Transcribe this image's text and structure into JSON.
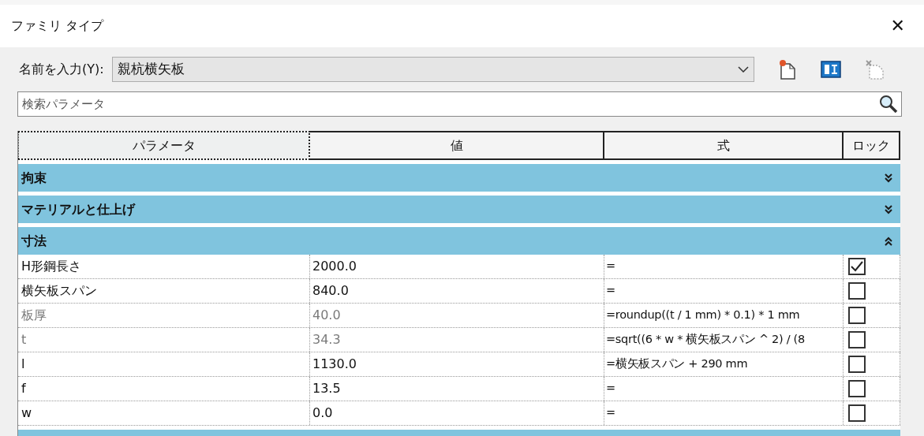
{
  "window": {
    "title": "ファミリ タイプ",
    "close": "✕"
  },
  "name_field": {
    "label": "名前を入力(Y):",
    "value": "親杭横矢板"
  },
  "search": {
    "placeholder": "検索パラメータ"
  },
  "columns": [
    "パラメータ",
    "値",
    "式",
    "ロック"
  ],
  "groups": [
    {
      "name": "拘束",
      "expanded": false
    },
    {
      "name": "マテリアルと仕上げ",
      "expanded": false
    },
    {
      "name": "寸法",
      "expanded": true,
      "rows": [
        {
          "parameter": "H形鋼長さ",
          "value": "2000.0",
          "formula": "=",
          "locked": true,
          "disabled": false
        },
        {
          "parameter": "横矢板スパン",
          "value": "840.0",
          "formula": "=",
          "locked": false,
          "disabled": false
        },
        {
          "parameter": "板厚",
          "value": "40.0",
          "formula": "=roundup((t / 1 mm) * 0.1) * 1 mm",
          "locked": false,
          "disabled": true
        },
        {
          "parameter": "t",
          "value": "34.3",
          "formula": "=sqrt((6 * w * 横矢板スパン ^ 2) / (8",
          "locked": false,
          "disabled": true
        },
        {
          "parameter": "l",
          "value": "1130.0",
          "formula": "=横矢板スパン + 290 mm",
          "locked": false,
          "disabled": false
        },
        {
          "parameter": "f",
          "value": "13.5",
          "formula": "=",
          "locked": false,
          "disabled": false
        },
        {
          "parameter": "w",
          "value": "0.0",
          "formula": "=",
          "locked": false,
          "disabled": false
        }
      ]
    }
  ]
}
